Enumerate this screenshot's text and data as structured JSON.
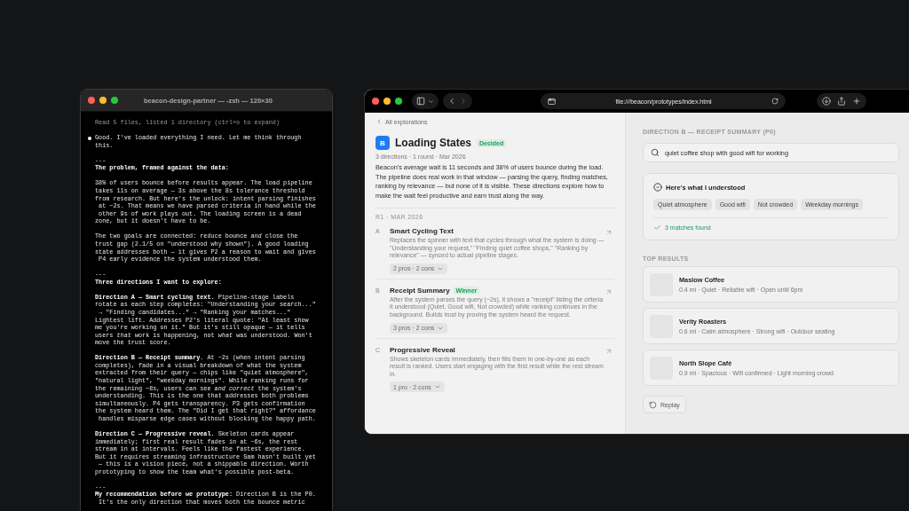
{
  "terminal": {
    "title": "beacon-design-partner — -zsh — 120×30",
    "blocks": [
      {
        "kind": "dim",
        "lines": [
          "Read 5 files, listed 1 directory (ctrl+o to expand)"
        ]
      },
      {
        "kind": "bullet",
        "lines": [
          "Good. I've loaded everything I need. Let me think through",
          "this."
        ]
      },
      {
        "kind": "text",
        "lines": [
          "---",
          "**The problem, framed against the data:**"
        ]
      },
      {
        "kind": "text",
        "lines": [
          "38% of users bounce before results appear. The load pipeline",
          "takes 11s on average — 3s above the 8s tolerance threshold",
          "from research. But here's the unlock: intent parsing finishes",
          " at ~2s. That means we have parsed criteria in hand while the",
          " other 9s of work plays out. The loading screen is a dead",
          "zone, but it doesn't have to be."
        ]
      },
      {
        "kind": "text",
        "lines": [
          "The two goals are connected: reduce bounce *and* close the",
          "trust gap (2.1/5 on \"understood why shown\"). A good loading",
          "state addresses both — it gives P2 a reason to wait and gives",
          " P4 early evidence the system understood them."
        ]
      },
      {
        "kind": "text",
        "lines": [
          "---",
          "**Three directions I want to explore:**"
        ]
      },
      {
        "kind": "text",
        "lines": [
          "**Direction A — Smart cycling text.** Pipeline-stage labels",
          "rotate as each step completes: \"Understanding your search...\"",
          " → \"Finding candidates...\" → \"Ranking your matches...\"",
          "Lightest lift. Addresses P2's literal quote: \"At least show",
          "me you're working on it.\" But it's still opaque — it tells",
          "users *that* work is happening, not *what* was understood. Won't",
          "move the trust score."
        ]
      },
      {
        "kind": "text",
        "lines": [
          "**Direction B — Receipt summary**. At ~2s (when intent parsing",
          "completes), fade in a visual breakdown of what the system",
          "extracted from their query — chips like \"quiet atmosphere\",",
          "\"natural light\", \"weekday mornings\". While ranking runs for",
          "the remaining ~8s, users can see *and correct* the system's",
          "understanding. This is the one that addresses both problems",
          "simultaneously. P4 gets transparency. P3 gets confirmation",
          "the system heard them. The \"Did I get that right?\" affordance",
          " handles misparse edge cases without blocking the happy path."
        ]
      },
      {
        "kind": "text",
        "lines": [
          "**Direction C — Progressive reveal.** Skeleton cards appear",
          "immediately; first real result fades in at ~6s, the rest",
          "stream in at intervals. Feels like the fastest experience.",
          "But it requires streaming infrastructure Sam hasn't built yet",
          " — this is a vision piece, not a shippable direction. Worth",
          "prototyping to show the team what's possible post-beta."
        ]
      },
      {
        "kind": "text",
        "lines": [
          "---",
          "**My recommendation before we prototype:** Direction B is the P0.",
          " It's the only direction that moves both the bounce metric"
        ]
      }
    ]
  },
  "browser": {
    "url": "file:///beacon/prototypes/index.html",
    "back_link": "All explorations",
    "project_letter": "B",
    "title": "Loading States",
    "status": "Decided",
    "meta": "3 directions · 1 round · Mar 2026",
    "intro": "Beacon's average wait is 11 seconds and 38% of users bounce during the load. The pipeline does real work in that window — parsing the query, finding matches, ranking by relevance — but none of it is visible. These directions explore how to make the wait feel productive and earn trust along the way.",
    "round": "R1 · MAR 2026",
    "directions": [
      {
        "letter": "A",
        "title": "Smart Cycling Text",
        "description": "Replaces the spinner with text that cycles through what the system is doing — \"Understanding your request,\" \"Finding quiet coffee shops,\" \"Ranking by relevance\" — synced to actual pipeline stages.",
        "pill": "2 pros · 2 cons"
      },
      {
        "letter": "B",
        "title": "Receipt Summary",
        "tag": "Winner",
        "description": "After the system parses the query (~2s), it shows a \"receipt\" listing the criteria it understood (Quiet, Good wifi, Not crowded) while ranking continues in the background. Builds trust by proving the system heard the request.",
        "pill": "3 pros · 2 cons"
      },
      {
        "letter": "C",
        "title": "Progressive Reveal",
        "description": "Shows skeleton cards immediately, then fills them in one-by-one as each result is ranked. Users start engaging with the first result while the rest stream in.",
        "pill": "1 pro · 2 cons"
      }
    ],
    "preview": {
      "label": "DIRECTION B — RECEIPT SUMMARY (P0)",
      "query": "quiet coffee shop with good wifi for working",
      "understood_title": "Here's what I understood",
      "chips": [
        "Quiet atmosphere",
        "Good wifi",
        "Not crowded",
        "Weekday mornings"
      ],
      "matches": "3 matches found",
      "results_label": "TOP RESULTS",
      "results": [
        {
          "name": "Maslow Coffee",
          "meta": "0.4 mi · Quiet · Reliable wifi · Open until 6pm"
        },
        {
          "name": "Verity Roasters",
          "meta": "0.6 mi · Calm atmosphere · Strong wifi · Outdoor seating"
        },
        {
          "name": "North Slope Café",
          "meta": "0.9 mi · Spacious · Wifi confirmed · Light morning crowd"
        }
      ],
      "replay": "Replay"
    }
  }
}
